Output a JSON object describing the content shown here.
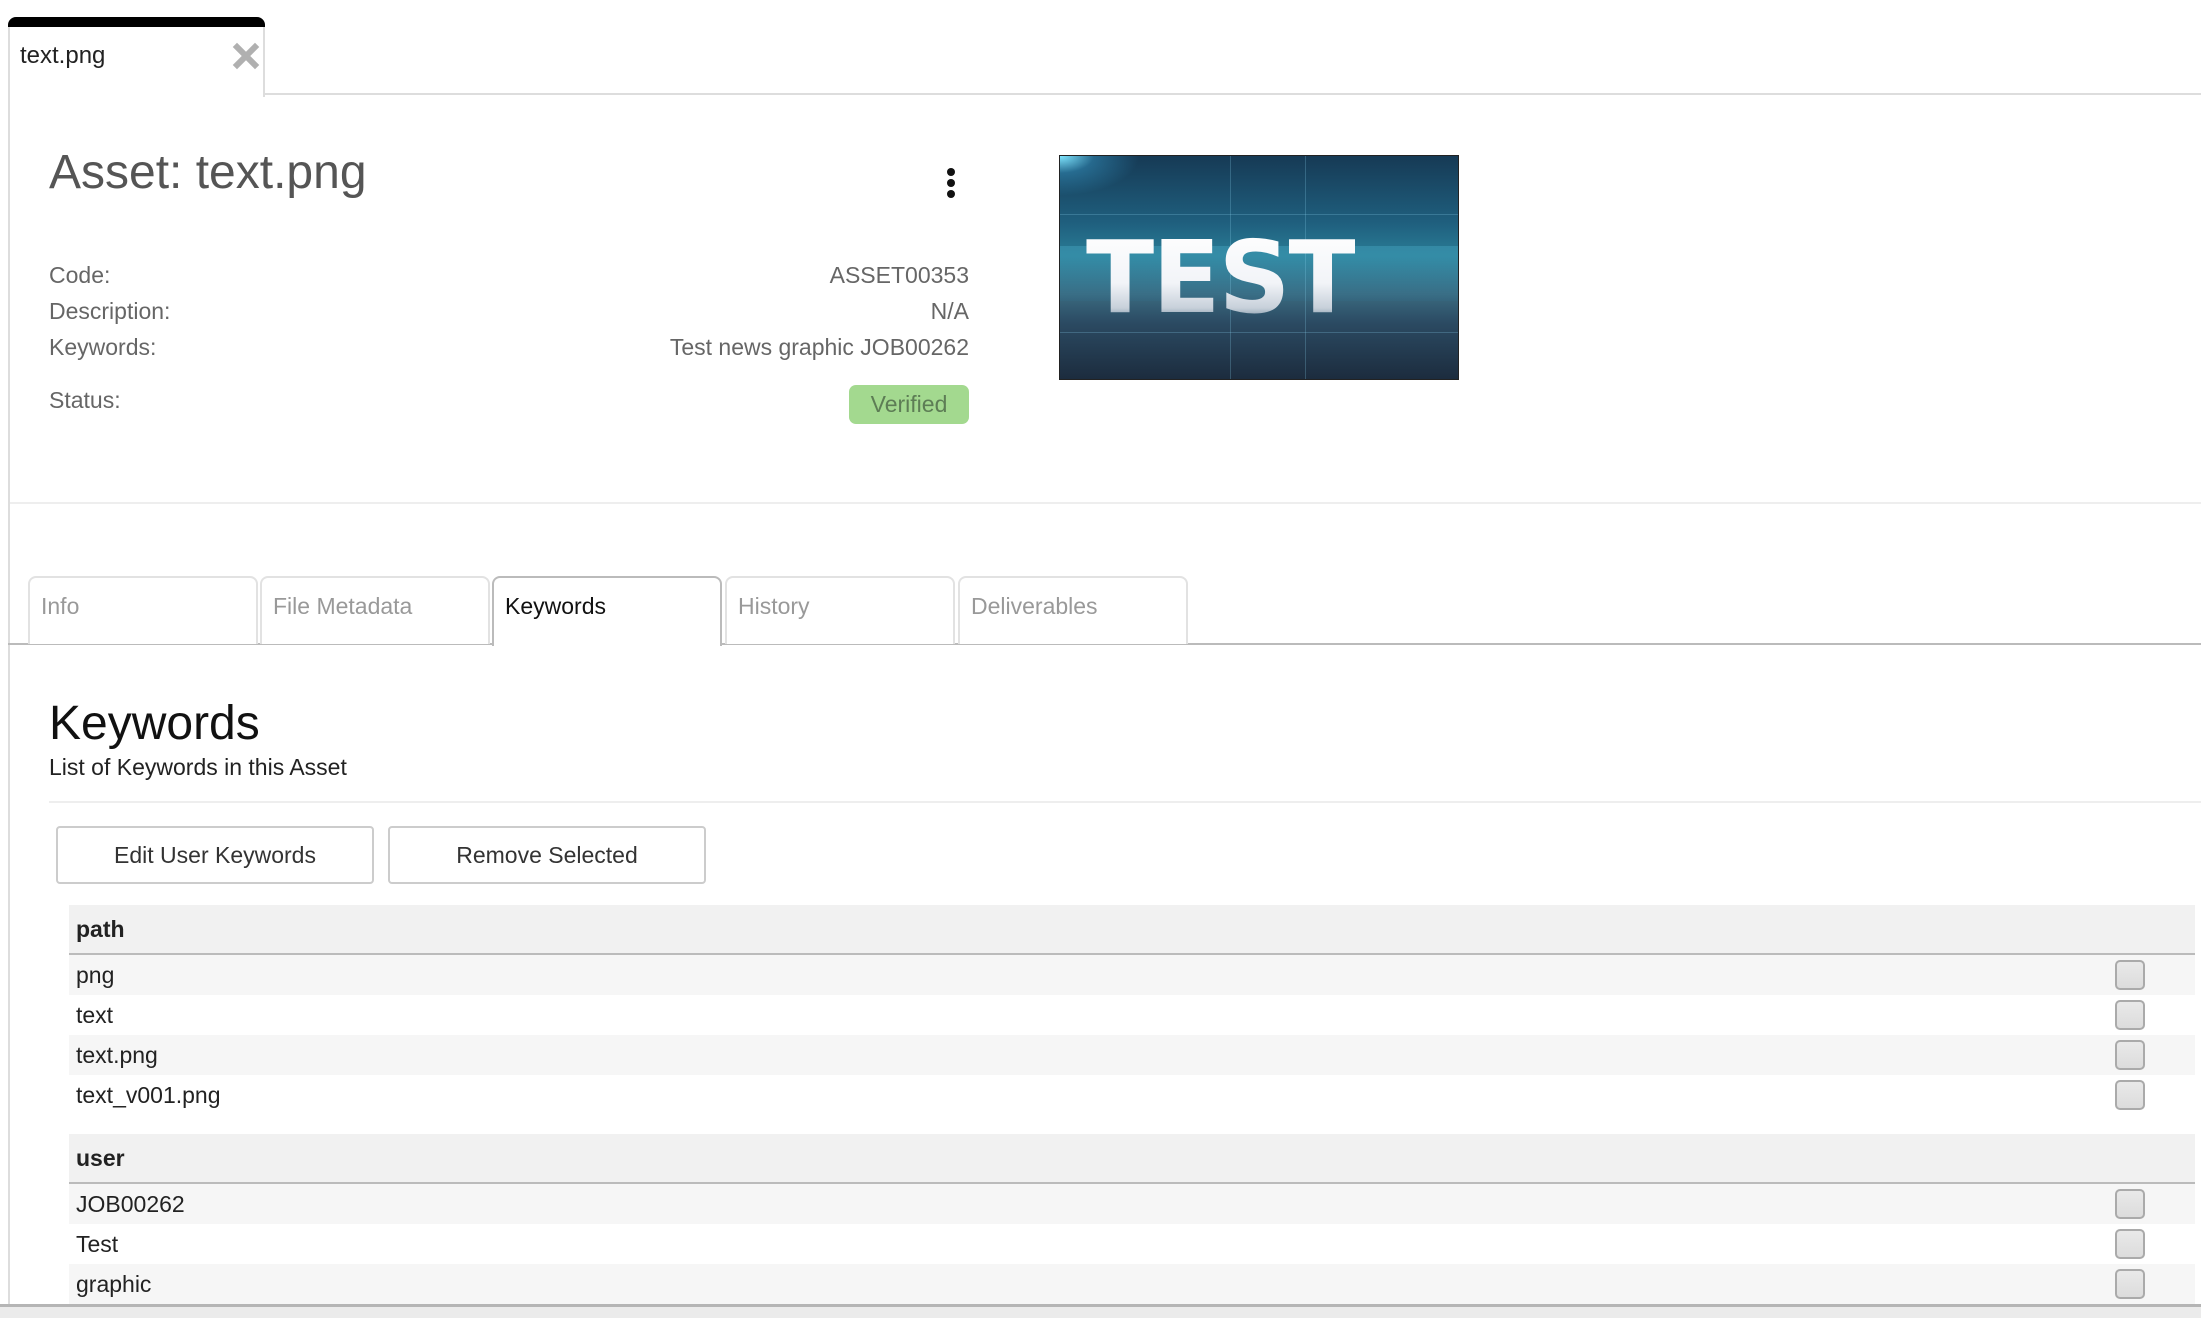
{
  "doc_tab": {
    "label": "text.png",
    "close_icon": "close-icon"
  },
  "asset": {
    "title": "Asset: text.png",
    "menu_icon": "more-vertical-icon",
    "fields": {
      "code": {
        "label": "Code:",
        "value": "ASSET00353"
      },
      "description": {
        "label": "Description:",
        "value": "N/A"
      },
      "keywords": {
        "label": "Keywords:",
        "value": "Test news graphic JOB00262"
      },
      "status": {
        "label": "Status:",
        "value": "Verified"
      }
    },
    "thumbnail": {
      "text": "TEST"
    },
    "colors": {
      "status_verified": "#a3d98f"
    }
  },
  "tabs": [
    {
      "label": "Info",
      "active": false
    },
    {
      "label": "File Metadata",
      "active": false
    },
    {
      "label": "Keywords",
      "active": true
    },
    {
      "label": "History",
      "active": false
    },
    {
      "label": "Deliverables",
      "active": false
    }
  ],
  "keywords_section": {
    "heading": "Keywords",
    "subtitle": "List of Keywords in this Asset",
    "buttons": {
      "edit": "Edit User Keywords",
      "remove": "Remove Selected"
    },
    "groups": [
      {
        "name": "path",
        "items": [
          {
            "label": "png",
            "checked": false
          },
          {
            "label": "text",
            "checked": false
          },
          {
            "label": "text.png",
            "checked": false
          },
          {
            "label": "text_v001.png",
            "checked": false
          }
        ]
      },
      {
        "name": "user",
        "items": [
          {
            "label": "JOB00262",
            "checked": false
          },
          {
            "label": "Test",
            "checked": false
          },
          {
            "label": "graphic",
            "checked": false
          }
        ]
      }
    ]
  }
}
